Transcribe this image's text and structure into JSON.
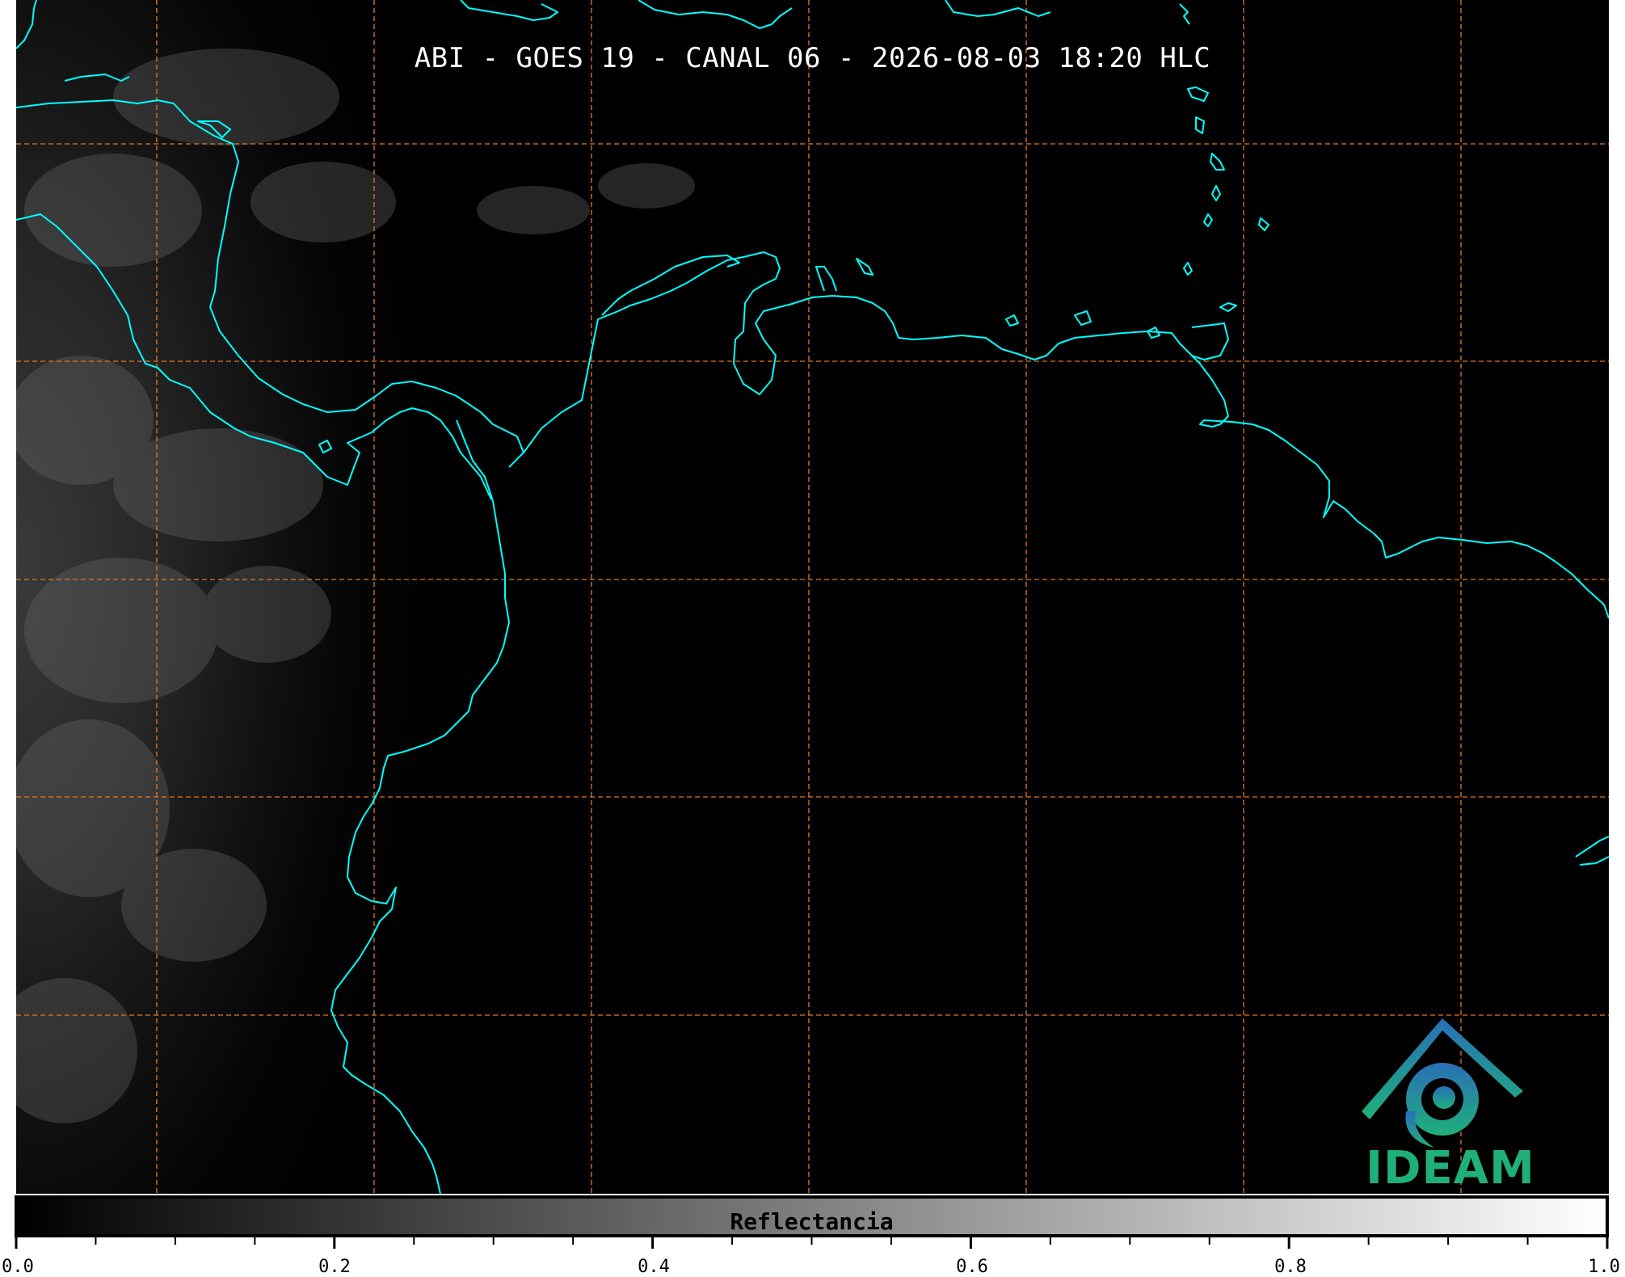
{
  "title": "ABI - GOES 19 - CANAL 06 - 2026-08-03 18:20 HLC",
  "logo": {
    "text": "IDEAM"
  },
  "colorbar": {
    "label": "Reflectancia",
    "range": [
      0.0,
      1.0
    ],
    "colors": [
      "#000000",
      "#ffffff"
    ],
    "tick_labels": [
      "0.0",
      "0.2",
      "0.4",
      "0.6",
      "0.8",
      "1.0"
    ]
  },
  "colors": {
    "coastline": "#00ffff",
    "gridlines": "#e07a2a",
    "background": "#000000"
  }
}
